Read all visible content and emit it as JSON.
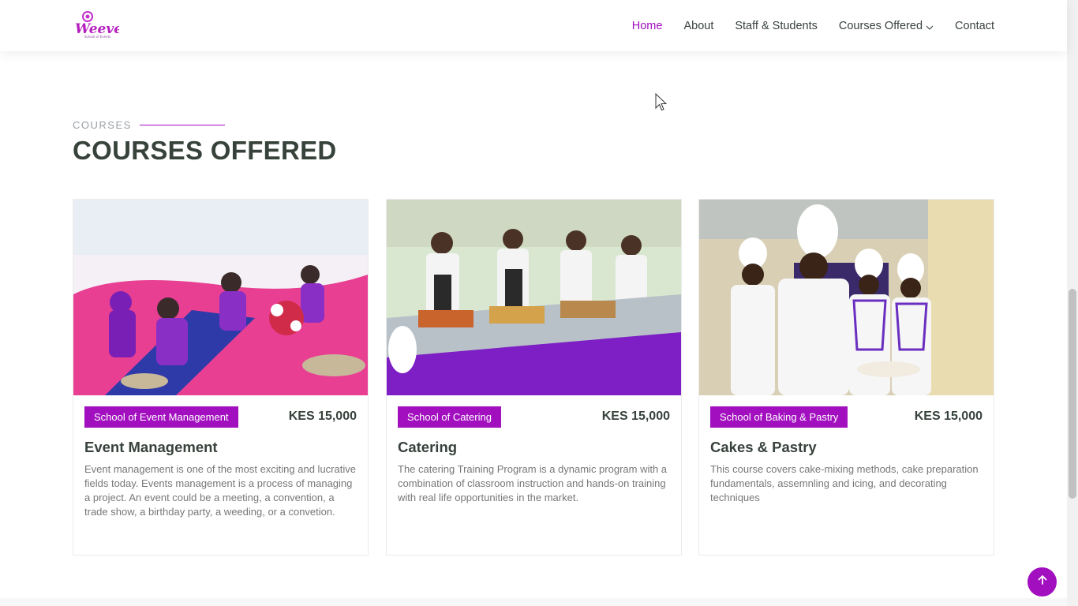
{
  "header": {
    "logo_alt": "Weevets",
    "nav": [
      {
        "label": "Home",
        "active": true
      },
      {
        "label": "About"
      },
      {
        "label": "Staff & Students"
      },
      {
        "label": "Courses Offered",
        "icon": "chevron-down-icon"
      },
      {
        "label": "Contact"
      }
    ]
  },
  "section": {
    "eyebrow": "COURSES",
    "title": "COURSES OFFERED"
  },
  "courses": [
    {
      "school": "School of Event Management",
      "price": "KES 15,000",
      "title": "Event Management",
      "description": "Event management is one of the most exciting and lucrative fields today. Events management is a process of managing a project. An event could be a meeting, a convention, a trade show, a birthday party, a weeding, or a convetion.",
      "image": "event-management-photo"
    },
    {
      "school": "School of Catering",
      "price": "KES 15,000",
      "title": "Catering",
      "description": "The catering Training Program is a dynamic program with a combination of classroom instruction and hands-on training with real life opportunities in the market.",
      "image": "catering-photo"
    },
    {
      "school": "School of Baking & Pastry",
      "price": "KES 15,000",
      "title": "Cakes & Pastry",
      "description": "This course covers cake-mixing methods, cake preparation fundamentals, assemnling and icing, and decorating techniques",
      "image": "baking-pastry-photo"
    }
  ],
  "colors": {
    "accent": "#a20fbf",
    "heading": "#37423b",
    "body_text": "#777777"
  },
  "back_to_top_icon": "arrow-up-icon"
}
